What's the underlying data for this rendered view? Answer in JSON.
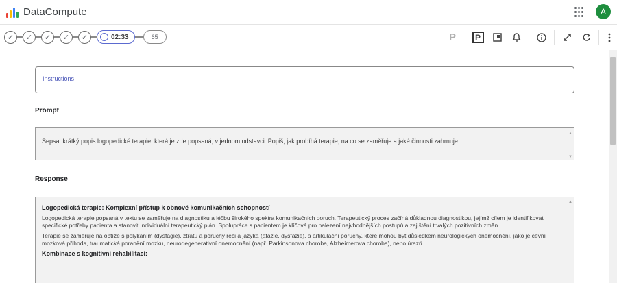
{
  "app": {
    "title": "DataCompute",
    "avatar_initial": "A",
    "logo_colors": [
      "#ea4335",
      "#fbbc04",
      "#4285f4",
      "#34a853"
    ]
  },
  "stepbar": {
    "completed_steps": 5,
    "timer": "02:33",
    "count": "65"
  },
  "toolbar": {
    "p_plain": "P",
    "p_box": "P"
  },
  "instructions": {
    "link": "Instructions"
  },
  "prompt": {
    "label": "Prompt",
    "text": "Sepsat krátký popis logopedické terapie, která je zde popsaná, v jednom odstavci. Popiš, jak probíhá terapie, na co se zaměřuje a jaké činnosti zahrnuje."
  },
  "response": {
    "label": "Response",
    "heading": "Logopedická terapie: Komplexní přístup k obnově komunikačních schopností",
    "paragraph1": "Logopedická terapie popsaná v textu se zaměřuje na diagnostiku a léčbu širokého spektra komunikačních poruch. Terapeutický proces začíná důkladnou diagnostikou, jejímž cílem je identifikovat specifické potřeby pacienta a stanovit individuální terapeutický plán. Spolupráce s pacientem je klíčová pro nalezení nejvhodnějších postupů a zajištění trvalých pozitivních změn.",
    "paragraph2": "Terapie se zaměřuje na obtíže s polykáním (dysfagie), ztrátu a poruchy řeči a jazyka (afázie, dysfázie), a artikulační poruchy, které mohou být důsledkem neurologických onemocnění, jako je cévní mozková příhoda, traumatická poranění mozku, neurodegenerativní onemocnění (např. Parkinsonova choroba, Alzheimerova choroba), nebo úrazů.",
    "heading2": "Kombinace s kognitivní rehabilitací:"
  }
}
